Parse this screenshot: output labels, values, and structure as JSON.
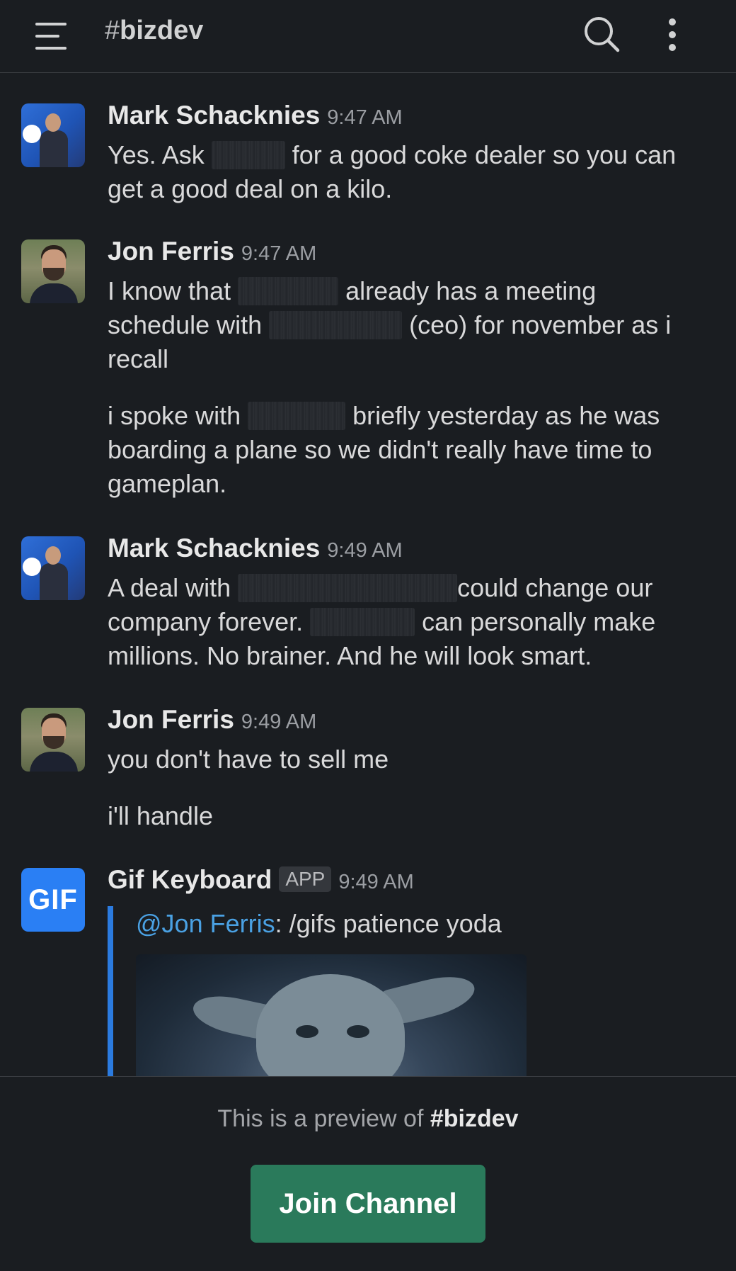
{
  "header": {
    "hash": "#",
    "channel": "bizdev"
  },
  "messages": [
    {
      "name": "Mark Schacknies",
      "time": "9:47 AM",
      "lines": [
        {
          "before": "Yes. Ask ",
          "after": " for a good coke dealer so you can"
        },
        {
          "text": "get a good deal on a kilo."
        }
      ]
    },
    {
      "name": "Jon Ferris",
      "time": "9:47 AM",
      "lines": [
        {
          "before": "I know that ",
          "after": " already has a meeting"
        },
        {
          "before": "schedule with ",
          "after": " (ceo) for november as i"
        },
        {
          "text": "recall"
        },
        {
          "before": "i spoke with ",
          "after": " briefly yesterday as he was"
        },
        {
          "text": "boarding a plane so we didn't really have time to"
        },
        {
          "text": "gameplan."
        }
      ]
    },
    {
      "name": "Mark Schacknies",
      "time": "9:49 AM",
      "lines": [
        {
          "before": "A deal with ",
          "after": "could change our"
        },
        {
          "before": "company forever. ",
          "after": " can personally make"
        },
        {
          "text": "millions. No brainer. And he will look smart."
        }
      ]
    },
    {
      "name": "Jon Ferris",
      "time": "9:49 AM",
      "lines": [
        {
          "text": "you don't have to sell me"
        },
        {
          "text": "i'll handle"
        }
      ]
    },
    {
      "name": "Gif Keyboard",
      "badge": "APP",
      "time": "9:49 AM",
      "avatar_text": "GIF",
      "mention": "@Jon Ferris",
      "command": ": /gifs patience yoda"
    }
  ],
  "footer": {
    "preview_prefix": "This is a preview of ",
    "preview_channel": "#bizdev",
    "join_label": "Join Channel"
  },
  "colors": {
    "background": "#1a1d21",
    "join_button": "#2a7a5b",
    "quote_bar": "#2b7be0",
    "mention": "#4aa1e3"
  },
  "icons": [
    "hamburger-menu-icon",
    "search-icon",
    "more-vertical-icon"
  ]
}
